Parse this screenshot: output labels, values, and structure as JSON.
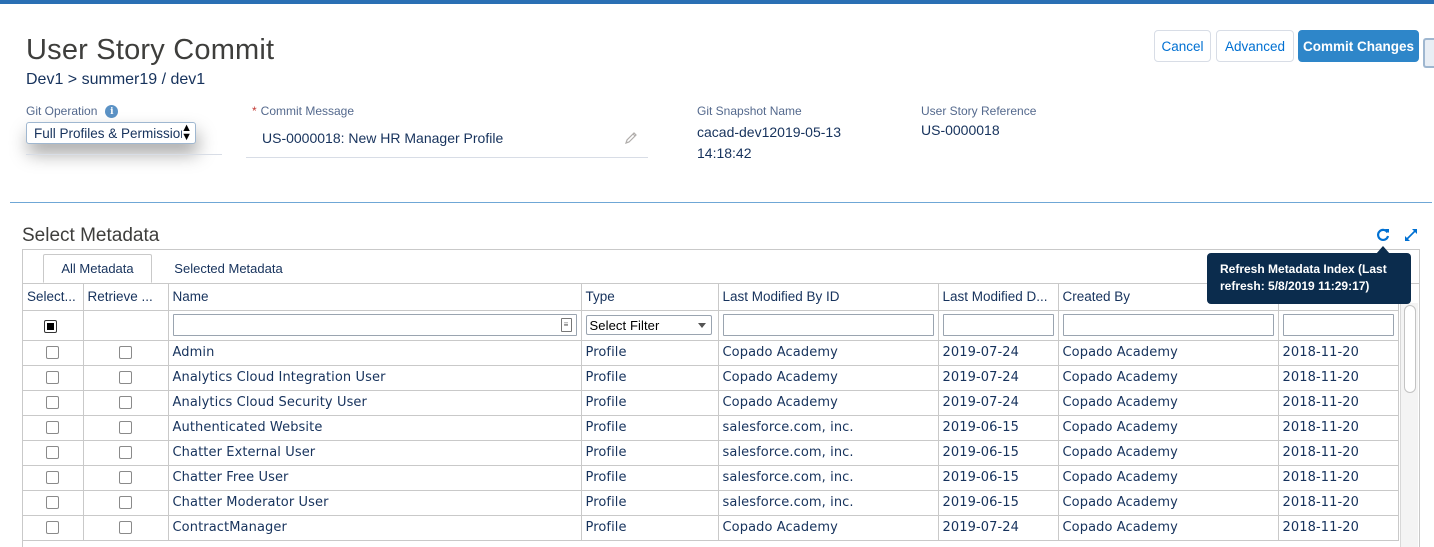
{
  "header": {
    "title": "User Story Commit",
    "breadcrumb": "Dev1 > summer19 / dev1",
    "buttons": {
      "cancel": "Cancel",
      "advanced": "Advanced",
      "commit": "Commit Changes"
    }
  },
  "form": {
    "git_operation": {
      "label": "Git Operation",
      "value": "Full Profiles & Permission Sets"
    },
    "commit_message": {
      "label": "Commit Message",
      "required_mark": "*",
      "value": "US-0000018: New HR Manager Profile"
    },
    "snapshot": {
      "label": "Git Snapshot Name",
      "line1": "cacad-dev12019-05-13",
      "line2": "14:18:42"
    },
    "user_story_ref": {
      "label": "User Story Reference",
      "value": "US-0000018"
    }
  },
  "metadata": {
    "section_title": "Select Metadata",
    "tabs": [
      "All Metadata",
      "Selected Metadata"
    ],
    "tooltip": "Refresh Metadata Index (Last refresh: 5/8/2019 11:29:17)",
    "columns": [
      "Select...",
      "Retrieve ...",
      "Name",
      "Type",
      "Last Modified By ID",
      "Last Modified D...",
      "Created By",
      ""
    ],
    "type_filter": "Select Filter",
    "rows": [
      [
        "Admin",
        "Profile",
        "Copado Academy",
        "2019-07-24",
        "Copado Academy",
        "2018-11-20"
      ],
      [
        "Analytics Cloud Integration User",
        "Profile",
        "Copado Academy",
        "2019-07-24",
        "Copado Academy",
        "2018-11-20"
      ],
      [
        "Analytics Cloud Security User",
        "Profile",
        "Copado Academy",
        "2019-07-24",
        "Copado Academy",
        "2018-11-20"
      ],
      [
        "Authenticated Website",
        "Profile",
        "salesforce.com, inc.",
        "2019-06-15",
        "Copado Academy",
        "2018-11-20"
      ],
      [
        "Chatter External User",
        "Profile",
        "salesforce.com, inc.",
        "2019-06-15",
        "Copado Academy",
        "2018-11-20"
      ],
      [
        "Chatter Free User",
        "Profile",
        "salesforce.com, inc.",
        "2019-06-15",
        "Copado Academy",
        "2018-11-20"
      ],
      [
        "Chatter Moderator User",
        "Profile",
        "salesforce.com, inc.",
        "2019-06-15",
        "Copado Academy",
        "2018-11-20"
      ],
      [
        "ContractManager",
        "Profile",
        "Copado Academy",
        "2019-07-24",
        "Copado Academy",
        "2018-11-20"
      ]
    ]
  },
  "colors": {
    "accent": "#2e86c9",
    "link": "#0070d2",
    "tooltip_bg": "#0b2c4d",
    "text": "#16325c"
  }
}
